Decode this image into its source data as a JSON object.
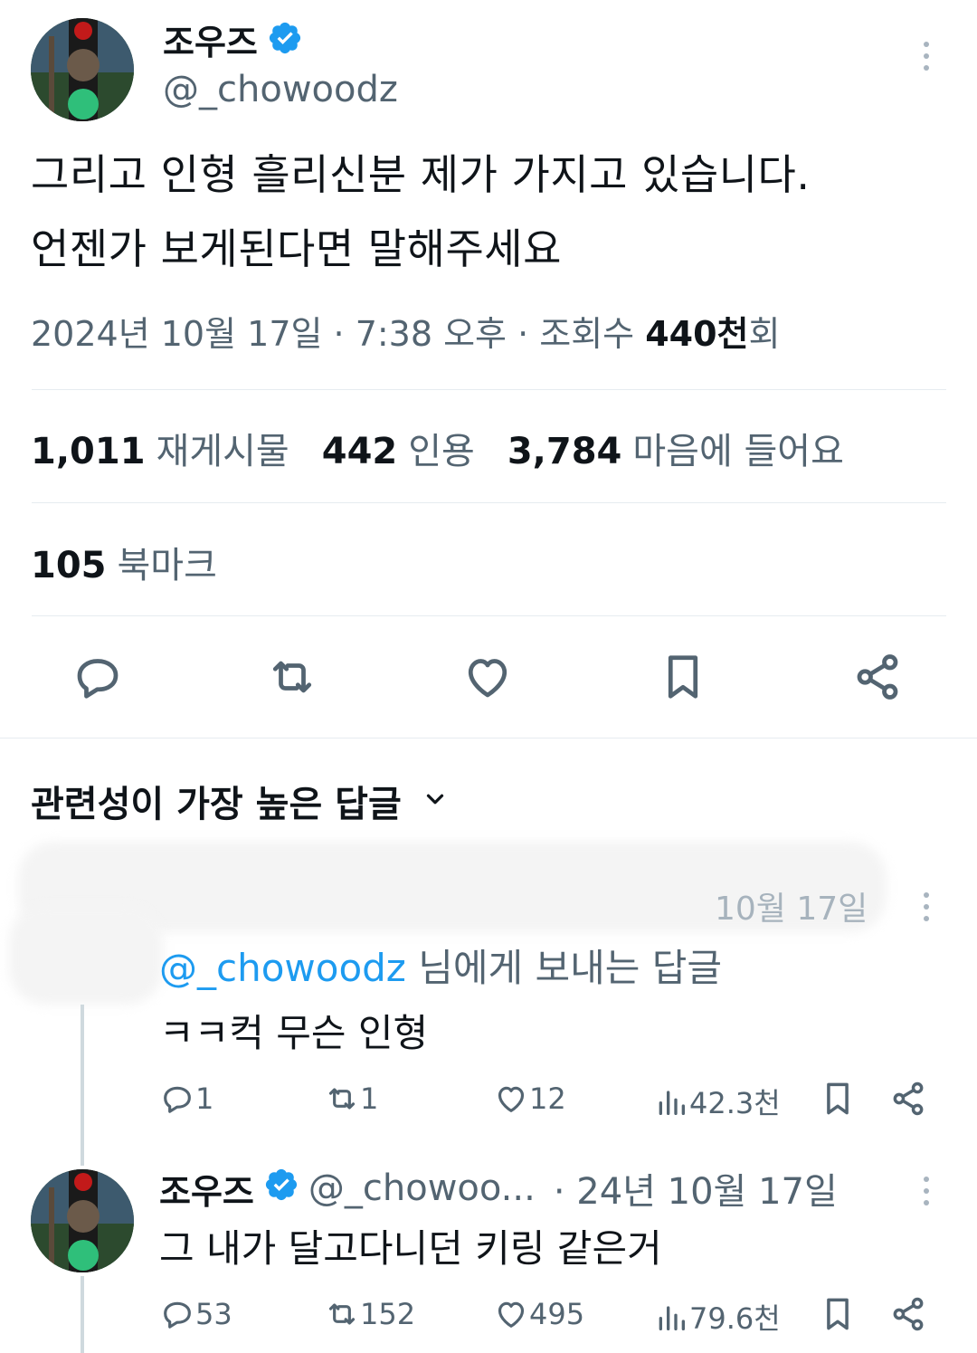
{
  "tweet": {
    "author_name": "조우즈",
    "author_handle": "@_chowoodz",
    "text_line1": "그리고 인형 흘리신분 제가 가지고 있습니다.",
    "text_line2": "언젠가 보게된다면 말해주세요",
    "date": "2024년 10월 17일 · 7:38 오후 · 조회수 ",
    "views_num": "440천",
    "views_suffix": "회"
  },
  "stats": {
    "retweets_num": "1,011",
    "retweets_label": "재게시물",
    "quotes_num": "442",
    "quotes_label": "인용",
    "likes_num": "3,784",
    "likes_label": "마음에 들어요",
    "bookmarks_num": "105",
    "bookmarks_label": "북마크"
  },
  "actions": [
    "reply-icon",
    "retweet-icon",
    "heart-icon",
    "bookmark-icon",
    "share-icon"
  ],
  "replies_sort": {
    "label": "관련성이 가장 높은 답글"
  },
  "reply1": {
    "date": "10월 17일",
    "replying_to_handle": "@_chowoodz",
    "replying_to_suffix": " 님에게 보내는 답글",
    "text": "ㅋㅋ컥 무슨 인형",
    "reply_count": "1",
    "retweet_count": "1",
    "like_count": "12",
    "view_count": "42.3천"
  },
  "reply2": {
    "author_name": "조우즈",
    "author_handle": "@_chowoo...",
    "date": "· 24년 10월 17일",
    "text": "그 내가 달고다니던 키링 같은거",
    "reply_count": "53",
    "retweet_count": "152",
    "like_count": "495",
    "view_count": "79.6천"
  },
  "colors": {
    "accent": "#1d9bf0",
    "text": "#0f1419",
    "secondary": "#536471",
    "border": "#e6ecf0"
  }
}
